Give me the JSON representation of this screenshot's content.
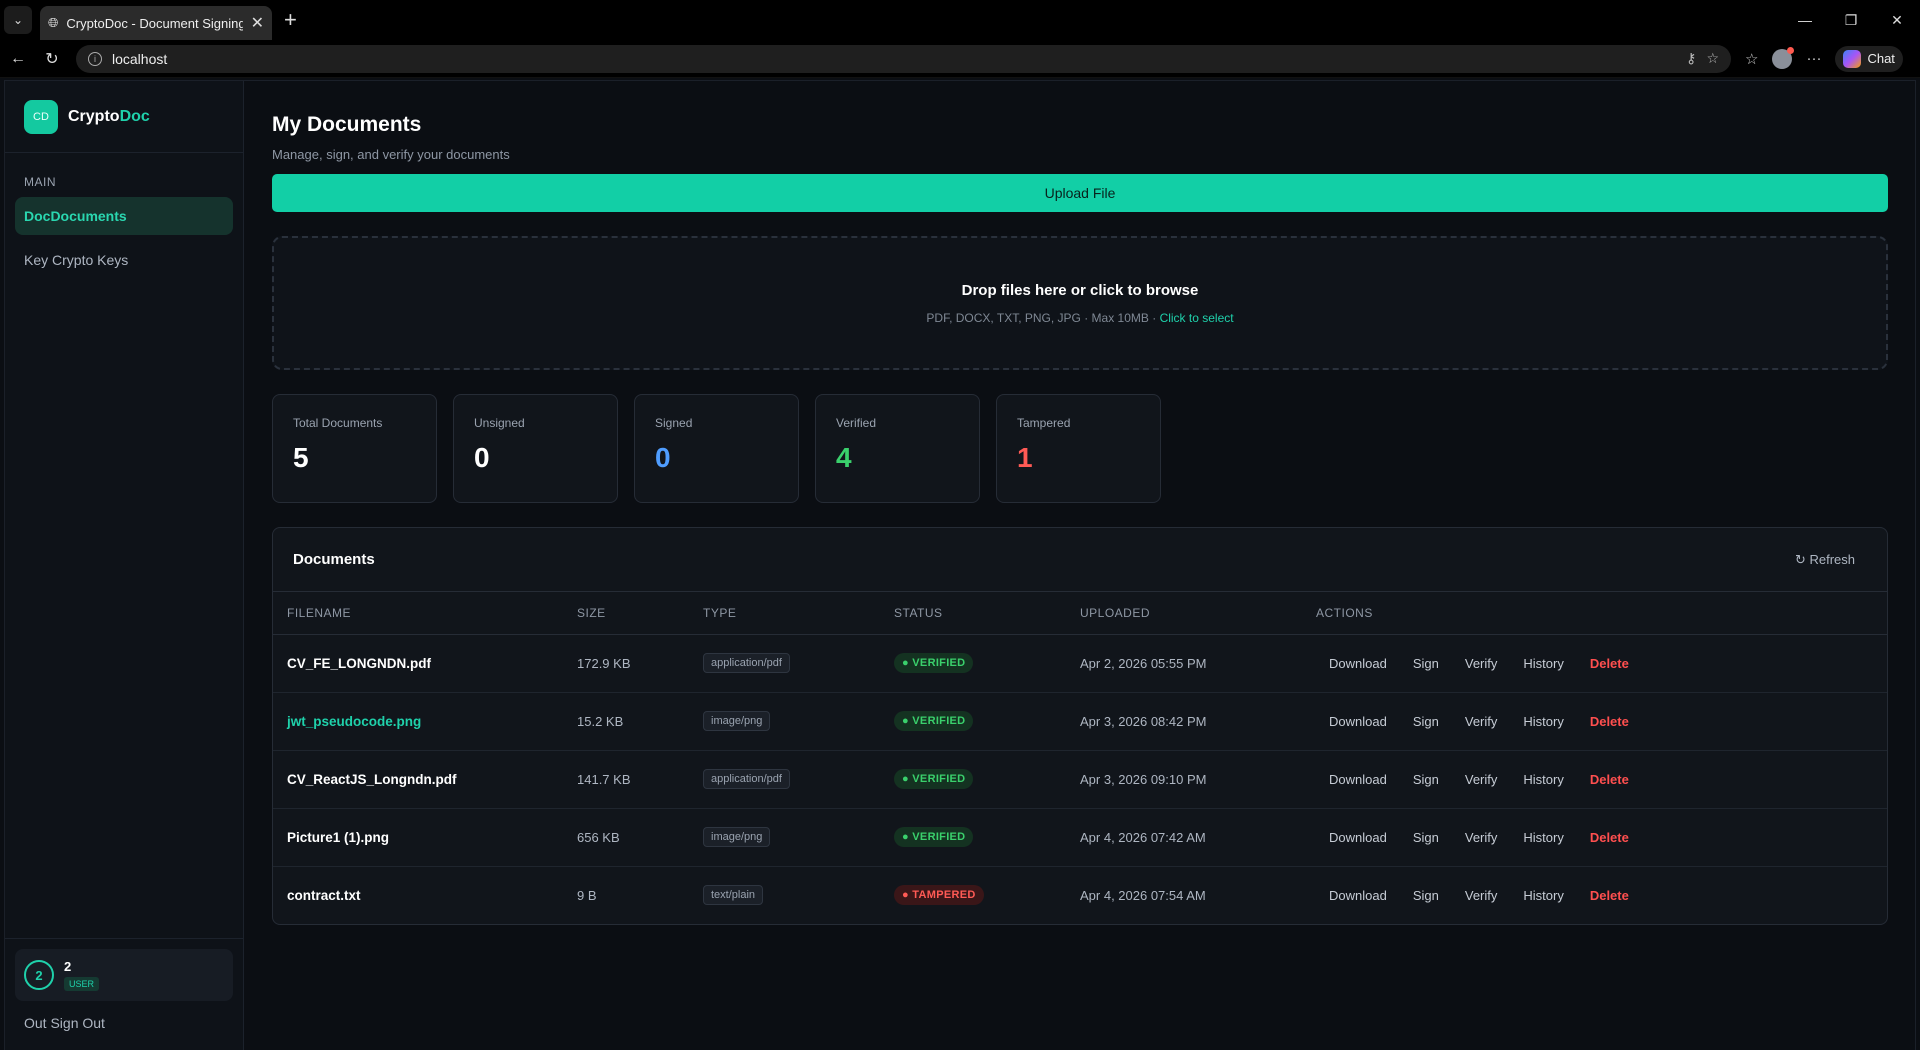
{
  "browser": {
    "tab_title": "CryptoDoc - Document Signing Pl",
    "url": "localhost",
    "chat_label": "Chat"
  },
  "brand": {
    "prefix": "Crypto",
    "suffix": "Doc",
    "logo_text": "CD"
  },
  "sidebar": {
    "section": "MAIN",
    "items": [
      {
        "label": "DocDocuments",
        "active": true
      },
      {
        "label": "Key Crypto Keys",
        "active": false
      }
    ],
    "user": {
      "avatar": "2",
      "name": "2",
      "role": "USER"
    },
    "signout": "Out Sign Out"
  },
  "page": {
    "title": "My Documents",
    "subtitle": "Manage, sign, and verify your documents",
    "upload_label": "Upload File"
  },
  "dropzone": {
    "title": "Drop files here or click to browse",
    "hint": "PDF, DOCX, TXT, PNG, JPG · Max 10MB · ",
    "link": "Click to select"
  },
  "stats": [
    {
      "label": "Total Documents",
      "value": "5",
      "color": "#ffffff"
    },
    {
      "label": "Unsigned",
      "value": "0",
      "color": "#ffffff"
    },
    {
      "label": "Signed",
      "value": "0",
      "color": "#4f9dff"
    },
    {
      "label": "Verified",
      "value": "4",
      "color": "#3ad06c"
    },
    {
      "label": "Tampered",
      "value": "1",
      "color": "#ff5a55"
    }
  ],
  "documents": {
    "title": "Documents",
    "refresh": "↻ Refresh",
    "columns": [
      "FILENAME",
      "SIZE",
      "TYPE",
      "STATUS",
      "UPLOADED",
      "ACTIONS"
    ],
    "actions": [
      "Download",
      "Sign",
      "Verify",
      "History",
      "Delete"
    ],
    "rows": [
      {
        "filename": "CV_FE_LONGNDN.pdf",
        "size": "172.9 KB",
        "type": "application/pdf",
        "status": "● VERIFIED",
        "uploaded": "Apr 2, 2026 05:55 PM"
      },
      {
        "filename": "jwt_pseudocode.png",
        "size": "15.2 KB",
        "type": "image/png",
        "status": "● VERIFIED",
        "uploaded": "Apr 3, 2026 08:42 PM"
      },
      {
        "filename": "CV_ReactJS_Longndn.pdf",
        "size": "141.7 KB",
        "type": "application/pdf",
        "status": "● VERIFIED",
        "uploaded": "Apr 3, 2026 09:10 PM"
      },
      {
        "filename": "Picture1 (1).png",
        "size": "656 KB",
        "type": "image/png",
        "status": "● VERIFIED",
        "uploaded": "Apr 4, 2026 07:42 AM"
      },
      {
        "filename": "contract.txt",
        "size": "9 B",
        "type": "text/plain",
        "status": "● TAMPERED",
        "uploaded": "Apr 4, 2026 07:54 AM"
      }
    ]
  }
}
